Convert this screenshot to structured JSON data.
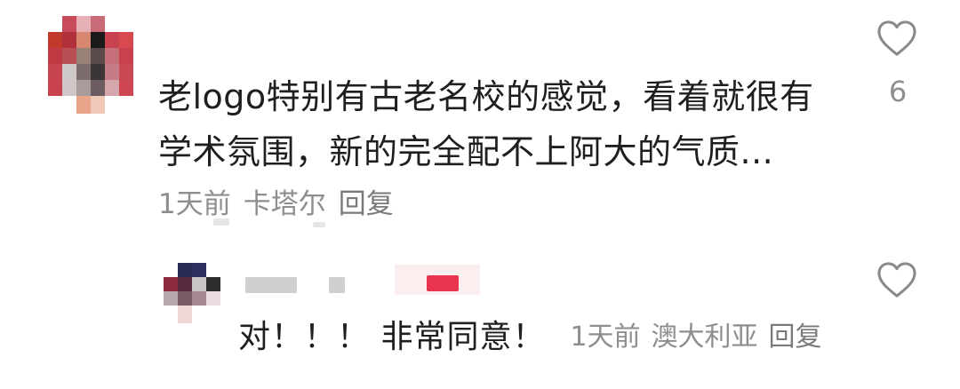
{
  "comment": {
    "text_line1": "老logo特别有古老名校的感觉，看着就很有",
    "text_line2": "学术氛围，新的完全配不上阿大的气质...",
    "time": "1天前",
    "location": "卡塔尔",
    "reply_label": "回复",
    "like_count": "6",
    "like_icon": "heart-outline-icon"
  },
  "reply": {
    "text": "对！！！ 非常同意！",
    "time": "1天前",
    "location": "澳大利亚",
    "reply_label": "回复",
    "like_icon": "heart-outline-icon"
  },
  "colors": {
    "primary_text": "#1f1f1f",
    "secondary_text": "#8e8e8e",
    "heart_stroke": "#8a8a8a",
    "badge_red": "#e8344e"
  }
}
